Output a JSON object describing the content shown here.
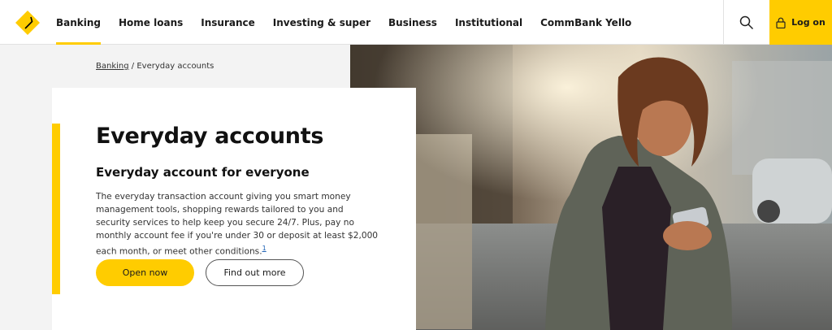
{
  "brand": {
    "accent": "#ffcc00",
    "logo_icon": "commbank-diamond-logo"
  },
  "header": {
    "nav_items": [
      {
        "label": "Banking",
        "active": true
      },
      {
        "label": "Home loans"
      },
      {
        "label": "Insurance"
      },
      {
        "label": "Investing & super"
      },
      {
        "label": "Business"
      },
      {
        "label": "Institutional"
      },
      {
        "label": "CommBank Yello"
      }
    ],
    "search_icon": "search-icon",
    "logon_label": "Log on",
    "logon_icon": "lock-icon"
  },
  "breadcrumb": {
    "parent": "Banking",
    "separator": " / ",
    "current": "Everyday accounts"
  },
  "hero": {
    "title": "Everyday accounts",
    "subtitle": "Everyday account for everyone",
    "description": "The everyday transaction account giving you smart money management tools, shopping rewards tailored to you and security services to help keep you secure 24/7. Plus, pay no monthly account fee if you're under 30 or deposit at least $2,000 each month, or meet other conditions.",
    "footnote": "1",
    "primary_button": "Open now",
    "secondary_button": "Find out more"
  }
}
